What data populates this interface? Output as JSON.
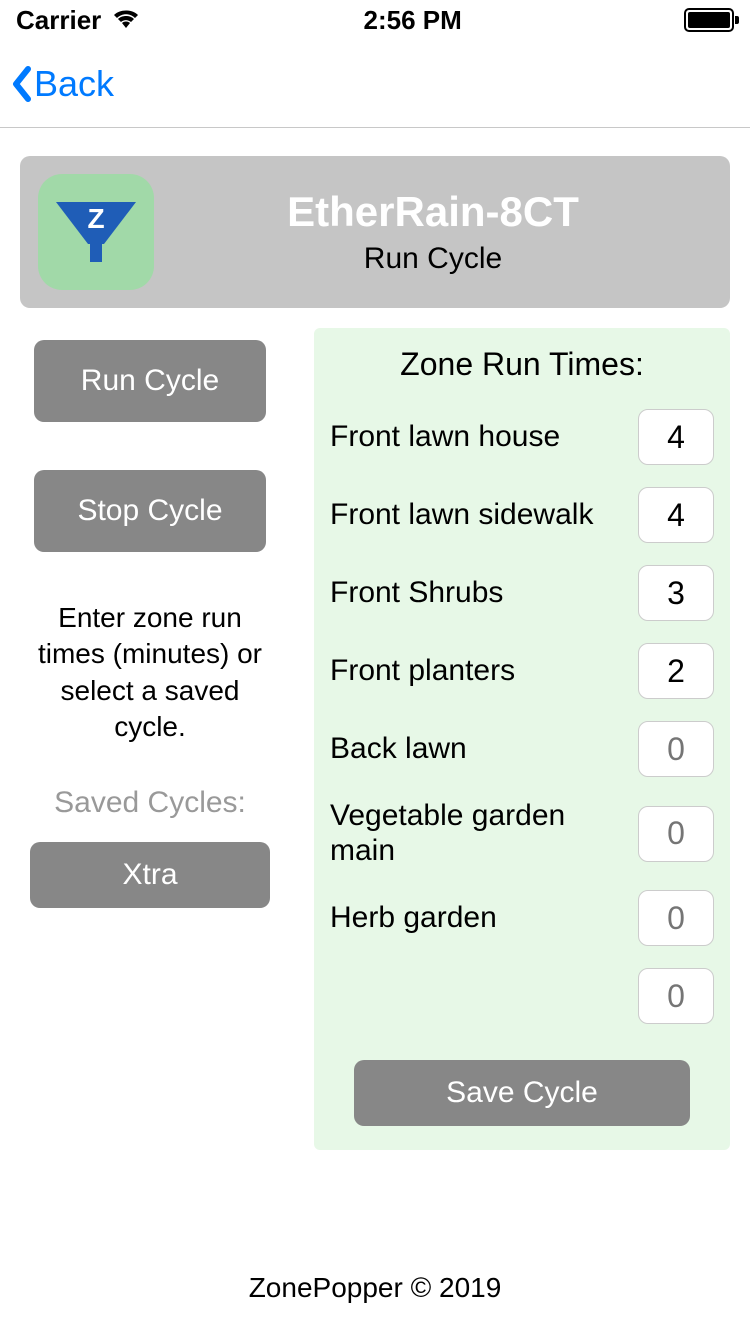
{
  "status": {
    "carrier": "Carrier",
    "time": "2:56 PM"
  },
  "nav": {
    "back_label": "Back"
  },
  "header": {
    "title": "EtherRain-8CT",
    "subtitle": "Run Cycle",
    "icon_letter": "Z"
  },
  "left": {
    "run_label": "Run Cycle",
    "stop_label": "Stop Cycle",
    "help_text": "Enter zone run times (minutes) or select a saved cycle.",
    "saved_heading": "Saved Cycles:",
    "saved_buttons": [
      "Xtra"
    ]
  },
  "right": {
    "title": "Zone Run Times:",
    "zones": [
      {
        "name": "Front lawn house",
        "value": "4"
      },
      {
        "name": "Front lawn sidewalk",
        "value": "4"
      },
      {
        "name": "Front Shrubs",
        "value": "3"
      },
      {
        "name": "Front planters",
        "value": "2"
      },
      {
        "name": "Back lawn",
        "value": "",
        "placeholder": "0"
      },
      {
        "name": "Vegetable garden main",
        "value": "",
        "placeholder": "0"
      },
      {
        "name": "Herb garden",
        "value": "",
        "placeholder": "0"
      },
      {
        "name": "",
        "value": "",
        "placeholder": "0"
      }
    ],
    "save_label": "Save Cycle"
  },
  "footer": {
    "text": "ZonePopper © 2019"
  }
}
